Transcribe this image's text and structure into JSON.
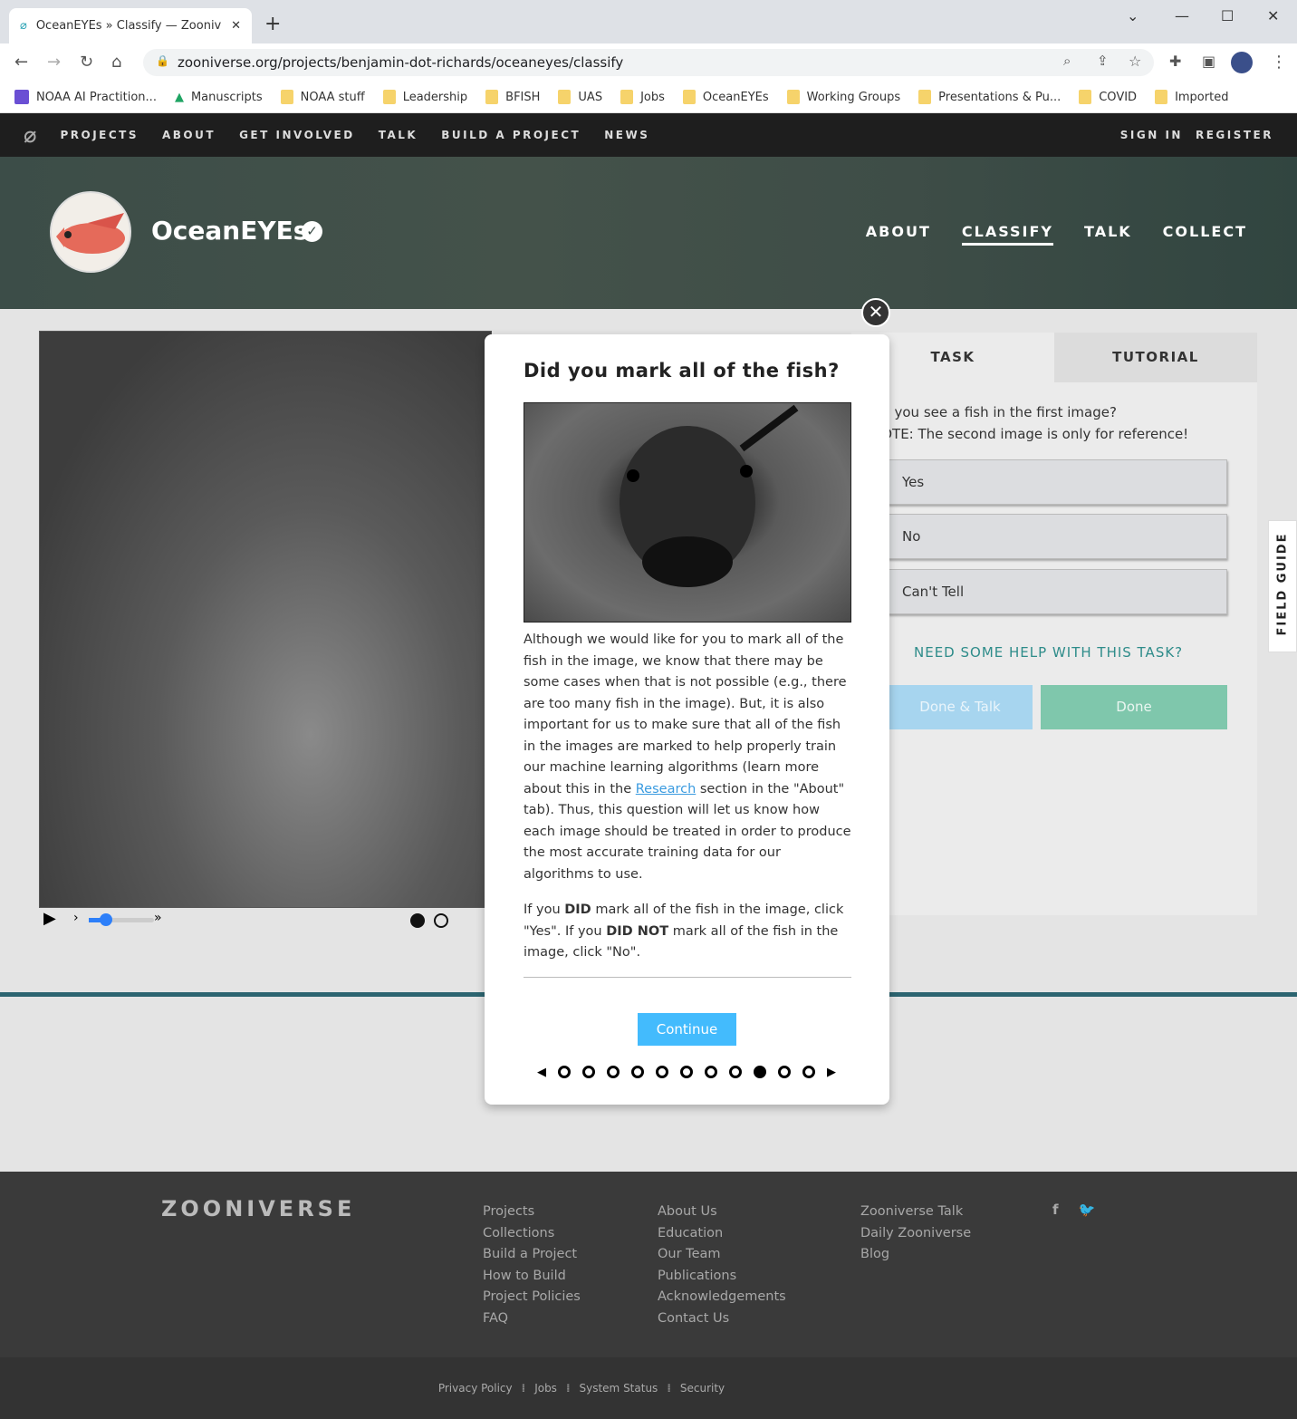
{
  "browser": {
    "tab_title": "OceanEYEs » Classify — Zooniverse",
    "url": "zooniverse.org/projects/benjamin-dot-richards/oceaneyes/classify",
    "bookmarks": [
      "NOAA AI Practition...",
      "Manuscripts",
      "NOAA stuff",
      "Leadership",
      "BFISH",
      "UAS",
      "Jobs",
      "OceanEYEs",
      "Working Groups",
      "Presentations & Pu...",
      "COVID",
      "Imported"
    ]
  },
  "site_nav": {
    "items": [
      "PROJECTS",
      "ABOUT",
      "GET INVOLVED",
      "TALK",
      "BUILD A PROJECT",
      "NEWS"
    ],
    "sign_in": "SIGN IN",
    "register": "REGISTER"
  },
  "project": {
    "title": "OceanEYEs",
    "nav": [
      "ABOUT",
      "CLASSIFY",
      "TALK",
      "COLLECT"
    ],
    "active_nav": "CLASSIFY"
  },
  "task": {
    "tabs": [
      "TASK",
      "TUTORIAL"
    ],
    "question": "Do you see a fish in the first image?",
    "note": "NOTE: The second image is only for reference!",
    "answers": [
      "Yes",
      "No",
      "Can't Tell"
    ],
    "help": "NEED SOME HELP WITH THIS TASK?",
    "done_talk": "Done & Talk",
    "done": "Done",
    "field_guide": "FIELD GUIDE"
  },
  "modal": {
    "title": "Did you mark all of the fish?",
    "p1_before": "Although we would like for you to mark all of the fish in the image, we know that there may be some cases when that is not possible (e.g., there are too many fish in the image). But, it is also important for us to make sure that all of the fish in the images are marked to help properly train our machine learning algorithms (learn more about this in the ",
    "p1_link": "Research",
    "p1_after": " section in the \"About\" tab). Thus, this question will let us know how each image should be treated in order to produce the most accurate training data for our algorithms to use.",
    "p2_a": "If you ",
    "p2_b": "DID",
    "p2_c": " mark all of the fish in the image, click \"Yes\". If you ",
    "p2_d": "DID NOT",
    "p2_e": " mark all of the fish in the image, click \"No\".",
    "continue": "Continue",
    "step_total": 11,
    "step_current": 9
  },
  "footer": {
    "logo": "ZOONIVERSE",
    "col1": [
      "Projects",
      "Collections",
      "Build a Project",
      "How to Build",
      "Project Policies",
      "FAQ"
    ],
    "col2": [
      "About Us",
      "Education",
      "Our Team",
      "Publications",
      "Acknowledgements",
      "Contact Us"
    ],
    "col3": [
      "Zooniverse Talk",
      "Daily Zooniverse",
      "Blog"
    ],
    "bottom": [
      "Privacy Policy",
      "Jobs",
      "System Status",
      "Security"
    ]
  }
}
